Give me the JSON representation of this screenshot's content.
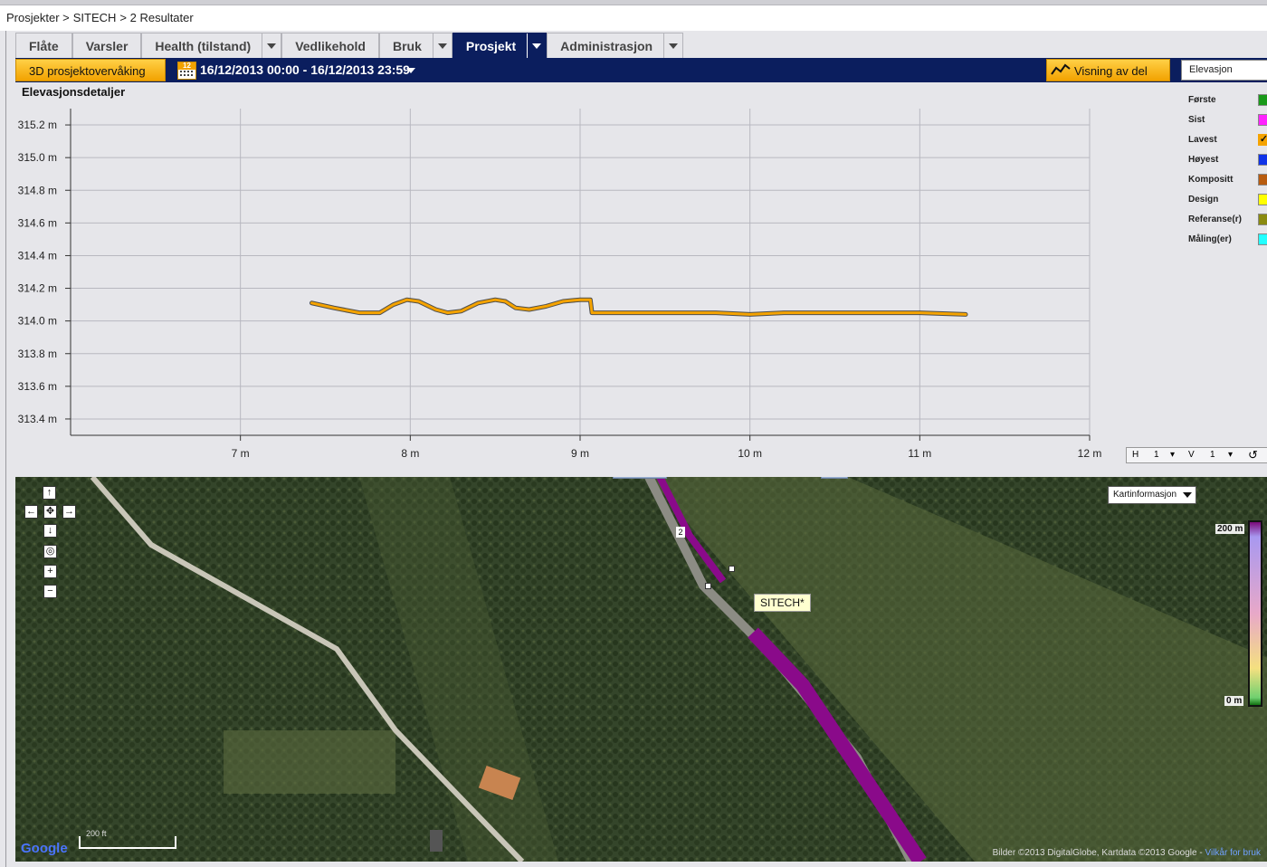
{
  "breadcrumb": [
    "Prosjekter >",
    "SITECH",
    "> 2 Resultater"
  ],
  "tabs": [
    {
      "label": "Flåte",
      "has_dropdown": false
    },
    {
      "label": "Varsler",
      "has_dropdown": false
    },
    {
      "label": "Health (tilstand)",
      "has_dropdown": true
    },
    {
      "label": "Vedlikehold",
      "has_dropdown": false
    },
    {
      "label": "Bruk",
      "has_dropdown": true
    },
    {
      "label": "Prosjekt",
      "has_dropdown": true,
      "active": true
    },
    {
      "label": "Administrasjon",
      "has_dropdown": true
    }
  ],
  "toolbar": {
    "monitor_label": "3D prosjektovervåking",
    "calendar_day": "12",
    "date_range": "16/12/2013 00:00 - 16/12/2013 23:59",
    "view_label": "Visning av del",
    "elevation_select": "Elevasjon"
  },
  "panel_title": "Elevasjonsdetaljer",
  "chart_data": {
    "type": "line",
    "title": "",
    "xlabel": "",
    "ylabel": "",
    "x_ticks": [
      "7 m",
      "8 m",
      "9 m",
      "10 m",
      "11 m",
      "12 m"
    ],
    "y_ticks": [
      "315.2 m",
      "315.0 m",
      "314.8 m",
      "314.6 m",
      "314.4 m",
      "314.2 m",
      "314.0 m",
      "313.8 m",
      "313.6 m",
      "313.4 m"
    ],
    "xlim": [
      6.0,
      12.0
    ],
    "ylim": [
      313.3,
      315.3
    ],
    "grid": true,
    "series": [
      {
        "color": "#f5a300",
        "x": [
          7.42,
          7.55,
          7.7,
          7.82,
          7.9,
          7.98,
          8.05,
          8.15,
          8.22,
          8.3,
          8.4,
          8.5,
          8.56,
          8.62,
          8.7,
          8.8,
          8.9,
          9.0,
          9.06,
          9.07,
          9.2,
          9.4,
          9.6,
          9.8,
          10.0,
          10.2,
          10.4,
          10.6,
          10.8,
          11.0,
          11.27
        ],
        "y": [
          314.11,
          314.08,
          314.05,
          314.05,
          314.1,
          314.13,
          314.12,
          314.07,
          314.05,
          314.06,
          314.11,
          314.13,
          314.12,
          314.08,
          314.07,
          314.09,
          314.12,
          314.13,
          314.13,
          314.05,
          314.05,
          314.05,
          314.05,
          314.05,
          314.04,
          314.05,
          314.05,
          314.05,
          314.05,
          314.05,
          314.04
        ]
      }
    ]
  },
  "legend": [
    {
      "label": "Første",
      "color": "#1a9a1a",
      "checked": false
    },
    {
      "label": "Sist",
      "color": "#ff22ff",
      "checked": false
    },
    {
      "label": "Lavest",
      "color": "#f5a300",
      "checked": true
    },
    {
      "label": "Høyest",
      "color": "#1033e8",
      "checked": false
    },
    {
      "label": "Kompositt",
      "color": "#b85c10",
      "checked": false
    },
    {
      "label": "Design",
      "color": "#ffff00",
      "checked": false
    },
    {
      "label": "Referanse(r)",
      "color": "#8a8a10",
      "checked": false
    },
    {
      "label": "Måling(er)",
      "color": "#22ffff",
      "checked": false
    }
  ],
  "hv_control": {
    "h_label": "H",
    "h_value": "1",
    "v_label": "V",
    "v_value": "1"
  },
  "map": {
    "info_dropdown": "Kartinformasjon",
    "scale_top": "200 m",
    "scale_bottom": "0 m",
    "tooltip": "SITECH*",
    "marker_label": "2",
    "scale_legend": "200 ft",
    "attribution": "Bilder ©2013 DigitalGlobe, Kartdata ©2013 Google -",
    "terms_link": "Vilkår for bruk",
    "logo": "Google",
    "nav": {
      "up": "↑",
      "down": "↓",
      "left": "←",
      "right": "→",
      "center": "✥",
      "locate": "◎",
      "zoom_in": "+",
      "zoom_out": "−"
    }
  }
}
